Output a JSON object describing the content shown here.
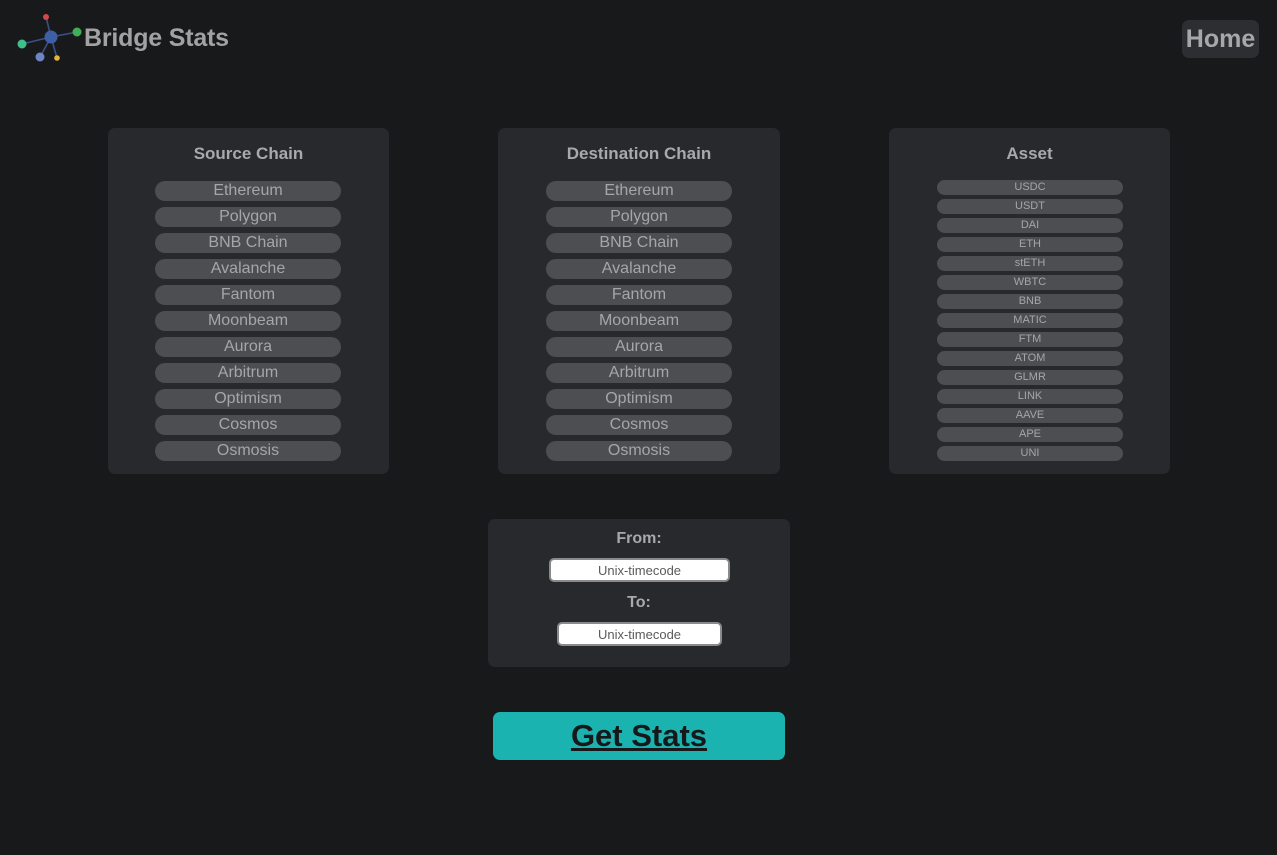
{
  "header": {
    "brand": "Bridge Stats",
    "home_label": "Home",
    "logo_icon": "network-nodes-icon"
  },
  "source": {
    "title": "Source Chain",
    "items": [
      "Ethereum",
      "Polygon",
      "BNB Chain",
      "Avalanche",
      "Fantom",
      "Moonbeam",
      "Aurora",
      "Arbitrum",
      "Optimism",
      "Cosmos",
      "Osmosis"
    ]
  },
  "destination": {
    "title": "Destination Chain",
    "items": [
      "Ethereum",
      "Polygon",
      "BNB Chain",
      "Avalanche",
      "Fantom",
      "Moonbeam",
      "Aurora",
      "Arbitrum",
      "Optimism",
      "Cosmos",
      "Osmosis"
    ]
  },
  "asset": {
    "title": "Asset",
    "items": [
      "USDC",
      "USDT",
      "DAI",
      "ETH",
      "stETH",
      "WBTC",
      "BNB",
      "MATIC",
      "FTM",
      "ATOM",
      "GLMR",
      "LINK",
      "AAVE",
      "APE",
      "UNI"
    ]
  },
  "time": {
    "from_label": "From:",
    "from_placeholder": "Unix-timecode",
    "to_label": "To:",
    "to_placeholder": "Unix-timecode"
  },
  "action": {
    "get_stats_label": "Get Stats"
  },
  "colors": {
    "background": "#18191b",
    "card": "#28292c",
    "option": "#4d4e52",
    "accent": "#1bb3b0"
  }
}
